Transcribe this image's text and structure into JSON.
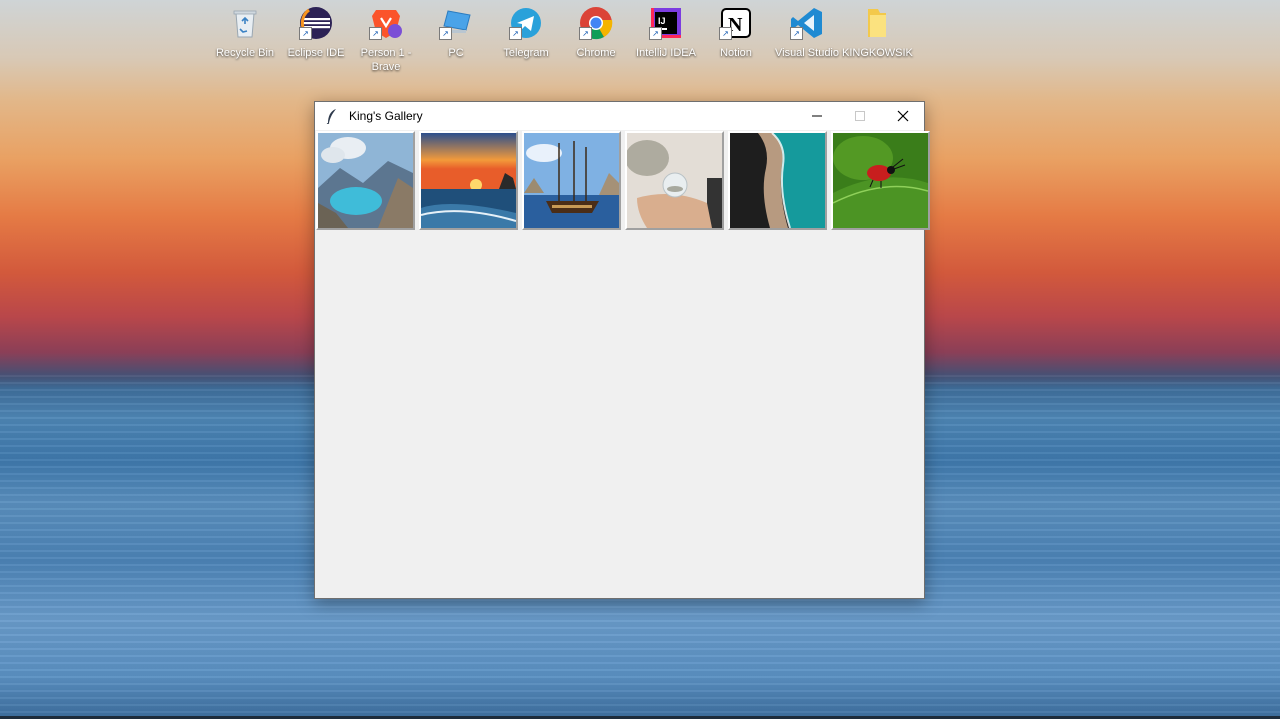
{
  "desktop": {
    "icons": [
      {
        "label": "Recycle Bin",
        "icon": "recycle-bin-icon",
        "shortcut": false
      },
      {
        "label": "Eclipse IDE",
        "icon": "eclipse-icon",
        "shortcut": true
      },
      {
        "label": "Person 1 - Brave",
        "icon": "brave-icon",
        "shortcut": true
      },
      {
        "label": "PC",
        "icon": "pc-icon",
        "shortcut": true
      },
      {
        "label": "Telegram",
        "icon": "telegram-icon",
        "shortcut": true
      },
      {
        "label": "Chrome",
        "icon": "chrome-icon",
        "shortcut": true
      },
      {
        "label": "IntelliJ IDEA",
        "icon": "intellij-icon",
        "shortcut": true
      },
      {
        "label": "Notion",
        "icon": "notion-icon",
        "shortcut": true
      },
      {
        "label": "Visual Studio",
        "icon": "vscode-icon",
        "shortcut": true
      },
      {
        "label": "KINGKOWSIK",
        "icon": "folder-icon",
        "shortcut": false
      }
    ]
  },
  "window": {
    "title": "King's Gallery",
    "icon": "feather-icon",
    "controls": [
      "minimize-icon",
      "maximize-icon",
      "close-icon"
    ],
    "thumbnails": [
      {
        "subject": "mountain-lake-thumbnail"
      },
      {
        "subject": "sunset-beach-thumbnail"
      },
      {
        "subject": "sailing-ship-thumbnail"
      },
      {
        "subject": "crystal-ball-hand-thumbnail"
      },
      {
        "subject": "aerial-coast-thumbnail"
      },
      {
        "subject": "ladybug-leaf-thumbnail"
      }
    ]
  },
  "colors": {
    "window_bg": "#f0f0f0",
    "titlebar_bg": "#ffffff"
  }
}
